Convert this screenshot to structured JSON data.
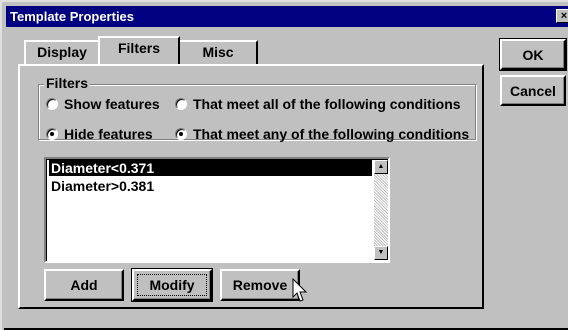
{
  "window": {
    "title": "Template Properties",
    "close_glyph": "×"
  },
  "tabs": [
    {
      "label": "Display",
      "active": false
    },
    {
      "label": "Filters",
      "active": true
    },
    {
      "label": "Misc",
      "active": false
    }
  ],
  "actions": {
    "ok_label": "OK",
    "cancel_label": "Cancel"
  },
  "filters": {
    "group_label": "Filters",
    "show_features_label": "Show features",
    "hide_features_label": "Hide features",
    "meet_all_label": "That meet all of the following conditions",
    "meet_any_label": "That meet any of the following conditions",
    "show_hide_selected": "hide",
    "all_any_selected": "any"
  },
  "conditions": {
    "items": [
      "Diameter<0.371",
      "Diameter>0.381"
    ],
    "selected_index": 0,
    "scroll_up_glyph": "▲",
    "scroll_down_glyph": "▼"
  },
  "list_buttons": {
    "add_label": "Add",
    "modify_label": "Modify",
    "remove_label": "Remove"
  },
  "icons": {
    "cursor": "mouse-pointer-icon"
  }
}
